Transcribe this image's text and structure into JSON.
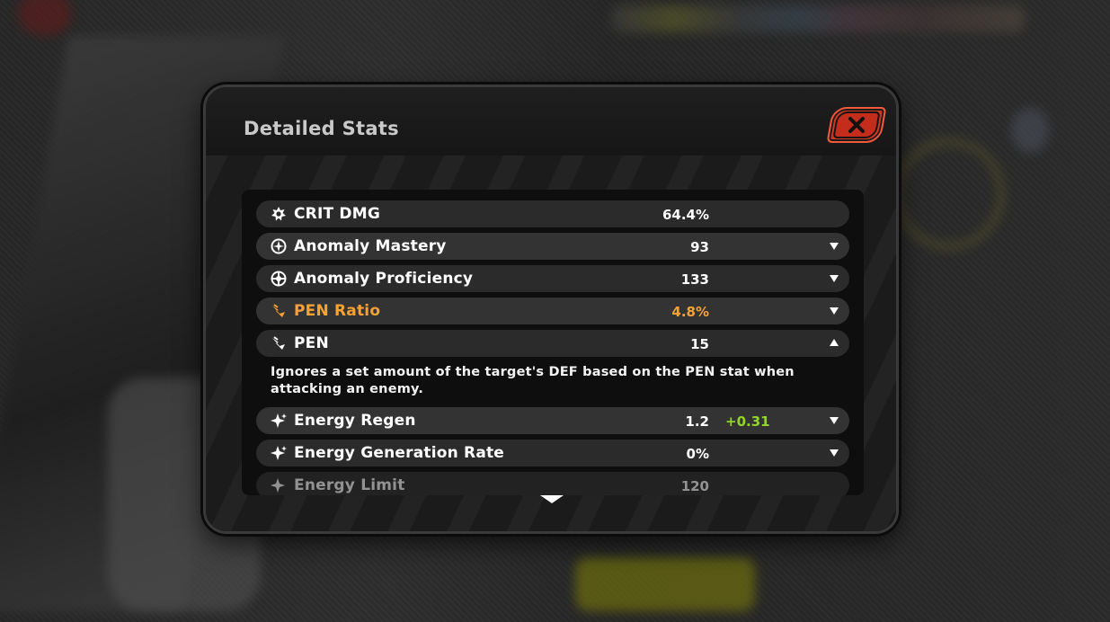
{
  "dialog": {
    "title": "Detailed Stats",
    "close_icon": "close-x-icon"
  },
  "stats": [
    {
      "label": "CRIT DMG",
      "value": "64.4%",
      "icon": "crit-dmg-icon",
      "expandable": false
    },
    {
      "label": "Anomaly Mastery",
      "value": "93",
      "icon": "anomaly-mastery-icon",
      "expandable": true
    },
    {
      "label": "Anomaly Proficiency",
      "value": "133",
      "icon": "anomaly-proficiency-icon",
      "expandable": true
    },
    {
      "label": "PEN Ratio",
      "value": "4.8%",
      "icon": "pen-ratio-icon",
      "expandable": true,
      "highlight_color": "#f7a232"
    },
    {
      "label": "PEN",
      "value": "15",
      "icon": "pen-icon",
      "expanded": true,
      "description": "Ignores a set amount of the target's DEF based on the PEN stat when attacking an enemy."
    },
    {
      "label": "Energy Regen",
      "value": "1.2",
      "bonus": "+0.31",
      "bonus_color": "#93d62a",
      "icon": "energy-regen-icon",
      "expandable": true
    },
    {
      "label": "Energy Generation Rate",
      "value": "0%",
      "icon": "energy-generation-icon",
      "expandable": true
    },
    {
      "label": "Energy Limit",
      "value": "120",
      "icon": "energy-limit-icon",
      "expandable": false
    }
  ],
  "scroll": {
    "icon": "scroll-down-icon"
  }
}
